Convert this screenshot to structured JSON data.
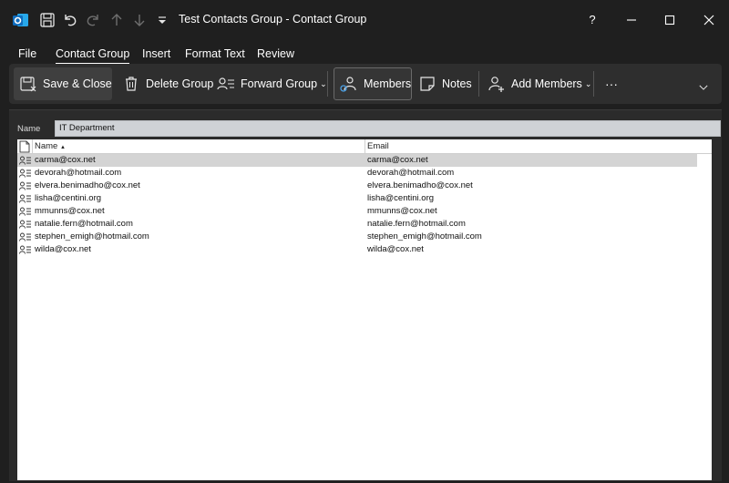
{
  "window": {
    "title": "Test Contacts Group  -  Contact Group",
    "help": "?"
  },
  "menu": {
    "tabs": [
      "File",
      "Contact Group",
      "Insert",
      "Format Text",
      "Review"
    ],
    "active": "Contact Group"
  },
  "ribbon": {
    "save_close": "Save & Close",
    "delete_group": "Delete Group",
    "forward_group": "Forward Group",
    "members": "Members",
    "notes": "Notes",
    "add_members": "Add Members",
    "more": "···"
  },
  "form": {
    "name_label": "Name",
    "name_value": "IT Department"
  },
  "table": {
    "columns": [
      "Name",
      "Email"
    ],
    "sort_indicator": "▲",
    "rows": [
      {
        "name": "carma@cox.net",
        "email": "carma@cox.net"
      },
      {
        "name": "devorah@hotmail.com",
        "email": "devorah@hotmail.com"
      },
      {
        "name": "elvera.benimadho@cox.net",
        "email": "elvera.benimadho@cox.net"
      },
      {
        "name": "lisha@centini.org",
        "email": "lisha@centini.org"
      },
      {
        "name": "mmunns@cox.net",
        "email": "mmunns@cox.net"
      },
      {
        "name": "natalie.fern@hotmail.com",
        "email": "natalie.fern@hotmail.com"
      },
      {
        "name": "stephen_emigh@hotmail.com",
        "email": "stephen_emigh@hotmail.com"
      },
      {
        "name": "wilda@cox.net",
        "email": "wilda@cox.net"
      }
    ]
  },
  "colors": {
    "background": "#1f1f1f",
    "ribbon": "#2e2e2e",
    "outlook_blue": "#0f6cbd",
    "selected_row": "#d4d4d4"
  }
}
